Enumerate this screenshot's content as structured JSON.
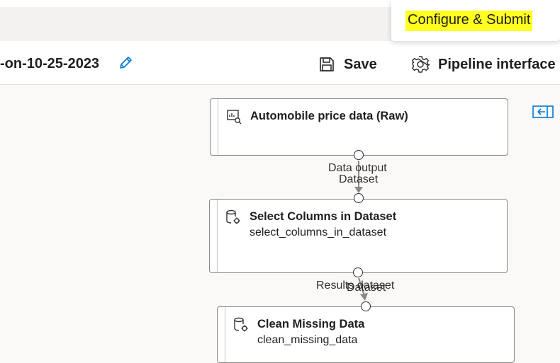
{
  "header": {
    "pipeline_title": "-on-10-25-2023",
    "save_label": "Save",
    "pipeline_interface_label": "Pipeline interface",
    "configure_submit_label": "Configure & Submit"
  },
  "icons": {
    "edit": "pencil-icon",
    "save": "floppy-disk-icon",
    "settings": "gear-icon",
    "collapse": "collapse-panel-icon",
    "dataset": "dataset-icon",
    "module": "database-gear-icon"
  },
  "nodes": [
    {
      "title": "Automobile price data (Raw)",
      "subtitle": ""
    },
    {
      "title": "Select Columns in Dataset",
      "subtitle": "select_columns_in_dataset"
    },
    {
      "title": "Clean Missing Data",
      "subtitle": "clean_missing_data"
    }
  ],
  "edges": [
    {
      "output_label": "Data output",
      "input_label": "Dataset"
    },
    {
      "output_label": "Results dataset",
      "input_label": "Dataset"
    }
  ],
  "colors": {
    "highlight": "#ffff20",
    "accent": "#0078d4",
    "edge": "#8a8886"
  }
}
